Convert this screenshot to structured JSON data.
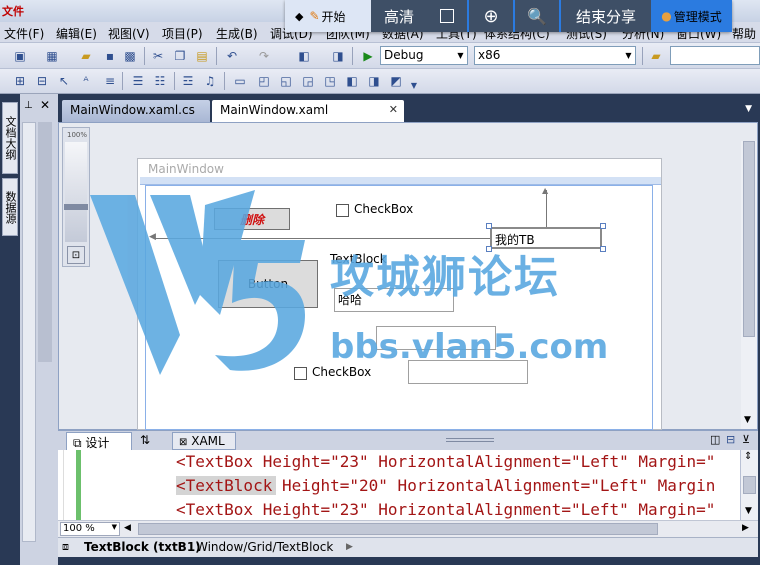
{
  "titlebar": {
    "text": "文件"
  },
  "menu": {
    "items": [
      "文件(F)",
      "编辑(E)",
      "视图(V)",
      "项目(P)",
      "生成(B)",
      "调试(D)",
      "团队(M)",
      "数据(A)",
      "工具(T)",
      "体系结构(C)",
      "测试(S)",
      "分析(N)",
      "窗口(W)",
      "帮助"
    ]
  },
  "share_bar": {
    "start_label": "开始",
    "hd_label": "高清",
    "end_share_label": "结束分享",
    "admin_label": "管理模式"
  },
  "toolbar": {
    "config_value": "Debug",
    "platform_value": "x86"
  },
  "left_dock": {
    "tab1": "文档大纲",
    "tab2": "数据源"
  },
  "tabs": {
    "tab1": "MainWindow.xaml.cs",
    "tab2": "MainWindow.xaml"
  },
  "designer": {
    "zoom_label": "100%",
    "window_title": "MainWindow",
    "delete_button": "删除",
    "checkbox1": "CheckBox",
    "textbox_mytb": "我的TB",
    "textblock": "TextBlock",
    "button": "Button",
    "textbox_haha": "哈哈",
    "checkbox2": "CheckBox"
  },
  "watermark": {
    "title": "攻城狮论坛",
    "url": "bbs.vlan5.com"
  },
  "bottom_tabs": {
    "design": "设计",
    "swap": "⇅",
    "xaml": "XAML"
  },
  "code": {
    "lines": [
      "<TextBox Height=\"23\" HorizontalAlignment=\"Left\" Margin=\"",
      "<TextBlock Height=\"20\" HorizontalAlignment=\"Left\" Margin",
      "<TextBox Height=\"23\" HorizontalAlignment=\"Left\" Margin=\""
    ],
    "zoom": "100 %"
  },
  "status": {
    "element": "TextBlock (txtB1)",
    "path": "Window/Grid/TextBlock"
  }
}
